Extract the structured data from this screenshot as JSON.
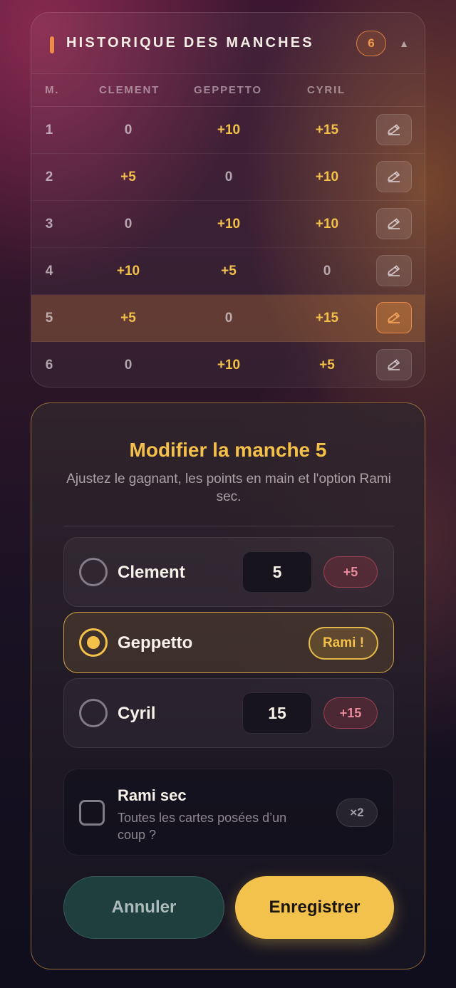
{
  "history": {
    "title": "HISTORIQUE DES MANCHES",
    "count": "6",
    "toggle_icon": "▲",
    "columns": [
      "M.",
      "CLEMENT",
      "GEPPETTO",
      "CYRIL"
    ],
    "rows": [
      {
        "round": "1",
        "scores": [
          "0",
          "+10",
          "+15"
        ]
      },
      {
        "round": "2",
        "scores": [
          "+5",
          "0",
          "+10"
        ]
      },
      {
        "round": "3",
        "scores": [
          "0",
          "+10",
          "+10"
        ]
      },
      {
        "round": "4",
        "scores": [
          "+10",
          "+5",
          "0"
        ]
      },
      {
        "round": "5",
        "scores": [
          "+5",
          "0",
          "+15"
        ]
      },
      {
        "round": "6",
        "scores": [
          "0",
          "+10",
          "+5"
        ]
      }
    ],
    "active_round": "5",
    "edit_icon": "pencil-icon"
  },
  "editor": {
    "title": "Modifier la manche 5",
    "subtitle": "Ajustez le gagnant, les points en main et l'option Rami sec.",
    "players": [
      {
        "name": "Clement",
        "points": "5",
        "delta": "+5",
        "selected": false
      },
      {
        "name": "Geppetto",
        "winner_chip": "Rami !",
        "selected": true
      },
      {
        "name": "Cyril",
        "points": "15",
        "delta": "+15",
        "selected": false
      }
    ],
    "option": {
      "title": "Rami sec",
      "description": "Toutes les cartes posées d’un coup ?",
      "multiplier": "×2",
      "checked": false
    },
    "cancel_label": "Annuler",
    "save_label": "Enregistrer"
  },
  "colors": {
    "accent_gold": "#f3c04a",
    "accent_orange": "#f08a4a",
    "delta_red": "#e88a9b",
    "cancel_teal": "#1e3f3d"
  }
}
